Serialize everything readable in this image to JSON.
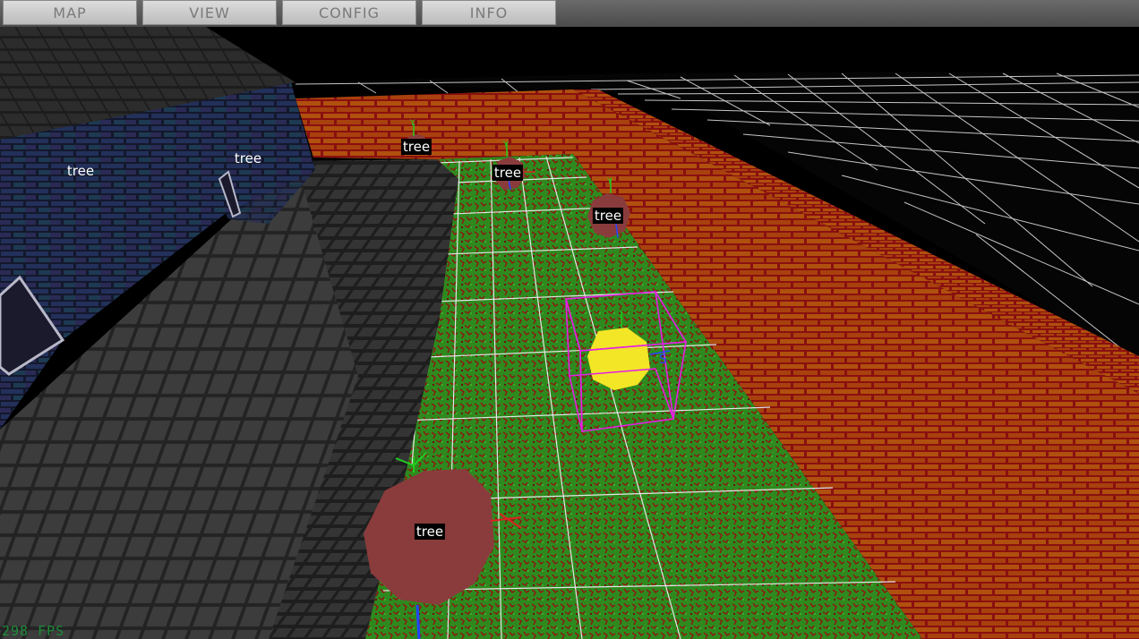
{
  "menu": {
    "items": [
      {
        "label": "MAP"
      },
      {
        "label": "VIEW"
      },
      {
        "label": "CONFIG"
      },
      {
        "label": "INFO"
      }
    ]
  },
  "scene": {
    "object_labels": [
      "tree",
      "tree",
      "tree",
      "tree",
      "tree",
      "tree"
    ],
    "fps_text": "298 FPS"
  },
  "colors": {
    "sky": "#000000",
    "brick_wall": "#a8410e",
    "brick_mortar": "#8a1010",
    "grass": "#2e8a1e",
    "grass_red": "#8a1a12",
    "dark_floor": "#3a3a3a",
    "blue_wall": "#1e2a4a",
    "tree_body": "#8a3c3c",
    "light_sphere": "#f2e626",
    "selection_box": "#e61ee6",
    "grid_line": "#ffffff",
    "fps_text": "#1d8c3a"
  }
}
